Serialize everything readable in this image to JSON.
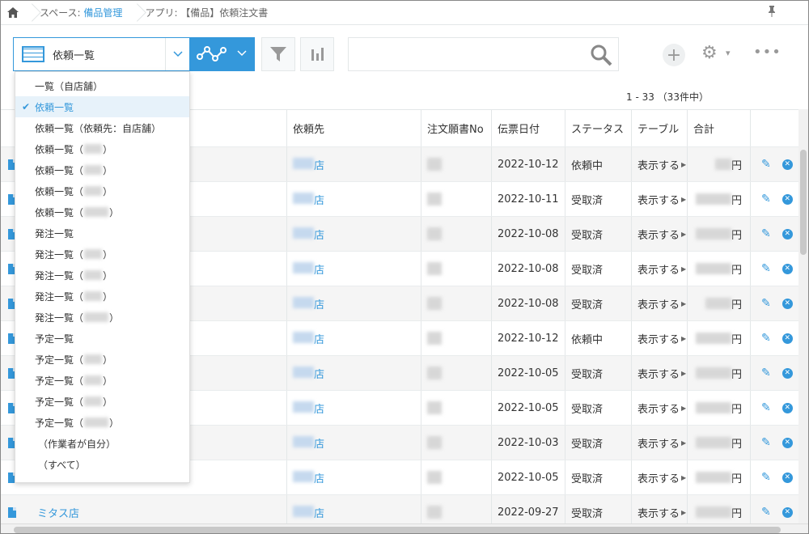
{
  "breadcrumb": {
    "space_prefix": "スペース: ",
    "space_name": "備品管理",
    "app": "アプリ: 【備品】依頼注文書"
  },
  "toolbar": {
    "view_label": "依頼一覧",
    "search_placeholder": "",
    "gear_chevron": "▾"
  },
  "record_count": "1 - 33 （33件中）",
  "table": {
    "headers": [
      "依頼先",
      "注文願書No",
      "伝票日付",
      "ステータス",
      "テーブル",
      "合計"
    ],
    "rows": [
      {
        "name": "",
        "vendor": "店",
        "date": "2022-10-12",
        "status": "依頼中",
        "table": "表示する",
        "total": "円"
      },
      {
        "name": "",
        "vendor": "店",
        "date": "2022-10-11",
        "status": "受取済",
        "table": "表示する",
        "total": "円"
      },
      {
        "name": "",
        "vendor": "店",
        "date": "2022-10-08",
        "status": "受取済",
        "table": "表示する",
        "total": "円"
      },
      {
        "name": "",
        "vendor": "店",
        "date": "2022-10-08",
        "status": "受取済",
        "table": "表示する",
        "total": "円"
      },
      {
        "name": "",
        "vendor": "店",
        "date": "2022-10-08",
        "status": "受取済",
        "table": "表示する",
        "total": "円"
      },
      {
        "name": "",
        "vendor": "店",
        "date": "2022-10-12",
        "status": "依頼中",
        "table": "表示する",
        "total": "円"
      },
      {
        "name": "",
        "vendor": "店",
        "date": "2022-10-05",
        "status": "受取済",
        "table": "表示する",
        "total": "円"
      },
      {
        "name": "",
        "vendor": "店",
        "date": "2022-10-05",
        "status": "受取済",
        "table": "表示する",
        "total": "円"
      },
      {
        "name": "",
        "vendor": "店",
        "date": "2022-10-03",
        "status": "受取済",
        "table": "表示する",
        "total": "円"
      },
      {
        "name": "",
        "vendor": "店",
        "date": "2022-10-05",
        "status": "受取済",
        "table": "表示する",
        "total": "円"
      },
      {
        "name": "ミタス店",
        "vendor": "店",
        "date": "2022-09-27",
        "status": "受取済",
        "table": "表示する",
        "total": "円"
      }
    ]
  },
  "dropdown": {
    "items": [
      {
        "label": "一覧（自店舗）"
      },
      {
        "label": "依頼一覧",
        "selected": true
      },
      {
        "label": "依頼一覧（依頼先：自店舗）"
      },
      {
        "label": "依頼一覧（",
        "suffix": "）"
      },
      {
        "label": "依頼一覧（",
        "suffix": "）"
      },
      {
        "label": "依頼一覧（",
        "suffix": "）"
      },
      {
        "label": "依頼一覧（",
        "suffix": "）",
        "wide": true
      },
      {
        "label": "発注一覧"
      },
      {
        "label": "発注一覧（",
        "suffix": "）"
      },
      {
        "label": "発注一覧（",
        "suffix": "）"
      },
      {
        "label": "発注一覧（",
        "suffix": "）"
      },
      {
        "label": "発注一覧（",
        "suffix": "）",
        "wide": true
      },
      {
        "label": "予定一覧"
      },
      {
        "label": "予定一覧（",
        "suffix": "）"
      },
      {
        "label": "予定一覧（",
        "suffix": "）"
      },
      {
        "label": "予定一覧（",
        "suffix": "）"
      },
      {
        "label": "予定一覧（",
        "suffix": "）",
        "wide": true
      },
      {
        "label": "（作業者が自分）",
        "indent": true
      },
      {
        "label": "（すべて）",
        "indent": true
      }
    ]
  },
  "colors": {
    "accent": "#3498db"
  }
}
